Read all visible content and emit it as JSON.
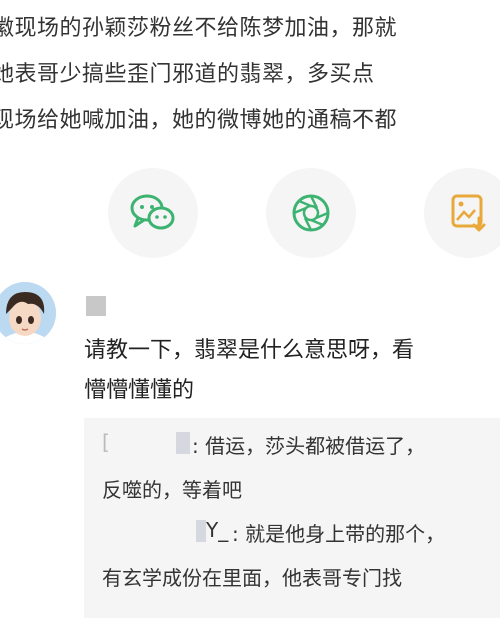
{
  "article": {
    "line1": "徽现场的孙颖莎粉丝不给陈梦加油，那就",
    "line2": "她表哥少搞些歪门邪道的翡翠，多买点",
    "line3": "现场给她喊加油，她的微博她的通稿不都"
  },
  "share": {
    "items": [
      {
        "icon": "wechat-icon",
        "color": "#3cb371"
      },
      {
        "icon": "moments-icon",
        "color": "#3cb371"
      },
      {
        "icon": "save-image-icon",
        "color": "#e8a93a"
      }
    ]
  },
  "comment": {
    "text_line1": "请教一下，翡翠是什么意思呀，看",
    "text_line2": "懵懵懂懂的",
    "replies": [
      {
        "bracket": "[",
        "line1": ": 借运，莎头都被借运了，",
        "line2": "反噬的，等着吧"
      },
      {
        "name_suffix": "Y_",
        "line1": ": 就是他身上带的那个，",
        "line2": "有玄学成份在里面，他表哥专门找"
      }
    ]
  }
}
